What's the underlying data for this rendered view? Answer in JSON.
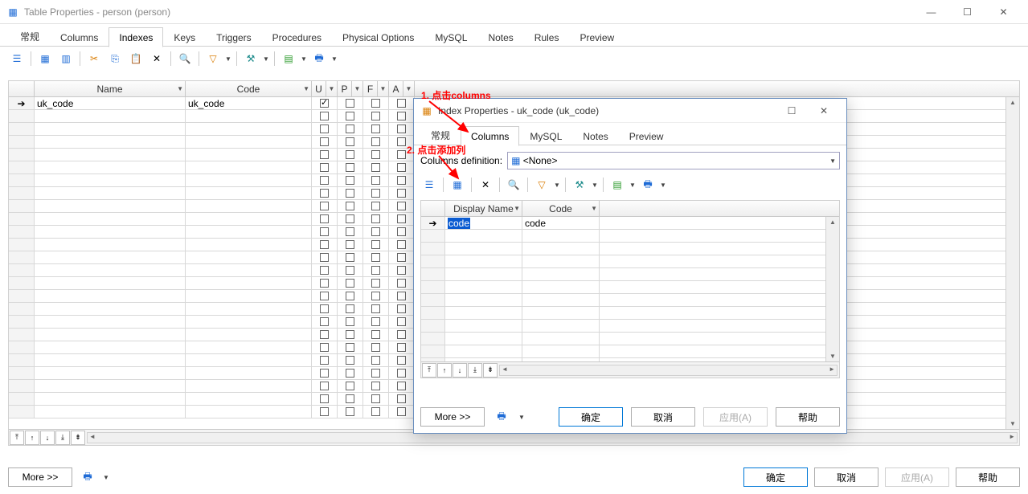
{
  "window": {
    "title": "Table Properties - person (person)",
    "min": "—",
    "max": "☐",
    "close": "✕"
  },
  "tabs": [
    "常规",
    "Columns",
    "Indexes",
    "Keys",
    "Triggers",
    "Procedures",
    "Physical Options",
    "MySQL",
    "Notes",
    "Rules",
    "Preview"
  ],
  "activeTab": 2,
  "grid": {
    "cols": {
      "name": "Name",
      "code": "Code",
      "u": "U",
      "p": "P",
      "f": "F",
      "a": "A"
    },
    "row": {
      "name": "uk_code",
      "code": "uk_code"
    }
  },
  "footer": {
    "more": "More >>",
    "ok": "确定",
    "cancel": "取消",
    "apply": "应用(A)",
    "help": "帮助"
  },
  "dialog": {
    "title": "Index Properties - uk_code (uk_code)",
    "tabs": [
      "常规",
      "Columns",
      "MySQL",
      "Notes",
      "Preview"
    ],
    "activeTab": 1,
    "colsDefLabel": "Columns definition:",
    "colsDefValue": "<None>",
    "gridCols": {
      "dn": "Display Name",
      "code": "Code"
    },
    "row": {
      "dn": "code",
      "code": "code"
    },
    "footer": {
      "more": "More >>",
      "ok": "确定",
      "cancel": "取消",
      "apply": "应用(A)",
      "help": "帮助"
    }
  },
  "ann": {
    "a1": "1. 点击columns",
    "a2": "2. 点击添加列"
  }
}
